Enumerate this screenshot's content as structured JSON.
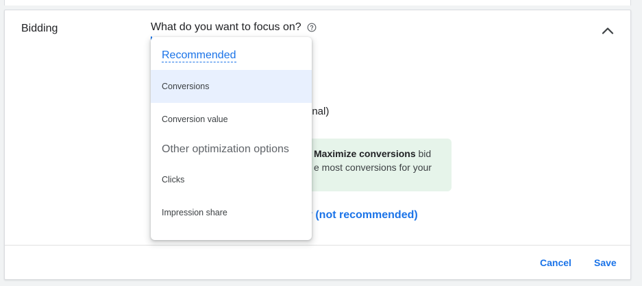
{
  "section": {
    "label": "Bidding",
    "question": "What do you want to focus on?"
  },
  "background": {
    "optional_fragment": "onal)",
    "info_bold": "Maximize conversions",
    "info_suffix": " bid",
    "info_line2": "e most conversions for your",
    "link_text": "y (not recommended)"
  },
  "dropdown": {
    "recommended_title": "Recommended",
    "recommended_options": [
      "Conversions",
      "Conversion value"
    ],
    "other_title": "Other optimization options",
    "other_options": [
      "Clicks",
      "Impression share"
    ],
    "selected": "Conversions"
  },
  "footer": {
    "cancel_label": "Cancel",
    "save_label": "Save"
  },
  "icons": {
    "help": "help-circle-icon",
    "collapse": "chevron-up-icon"
  },
  "colors": {
    "accent": "#1a73e8",
    "selected_bg": "#e8f0fe",
    "info_bg": "#e6f4ea"
  }
}
